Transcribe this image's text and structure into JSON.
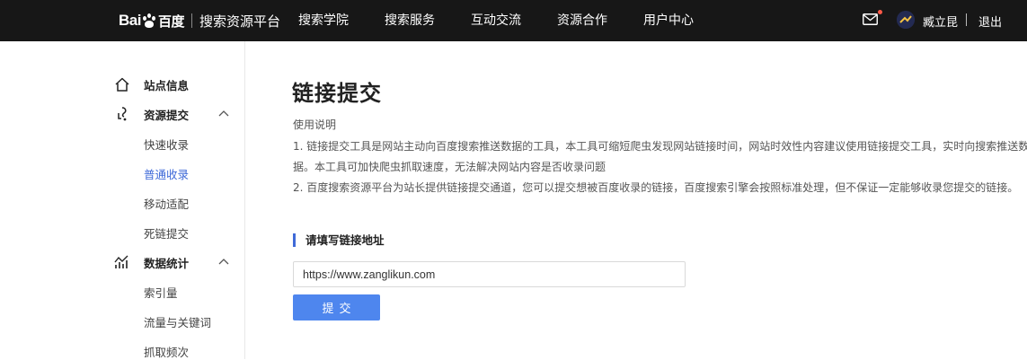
{
  "header": {
    "logo_text_1": "Bai",
    "logo_text_2": "百度",
    "logo_sub": "搜索资源平台",
    "nav": [
      "搜索学院",
      "搜索服务",
      "互动交流",
      "资源合作",
      "用户中心"
    ],
    "username": "臧立昆",
    "separator": "|",
    "logout": "退出",
    "mail_icon": "mail-icon",
    "notification_color": "#ff5a48"
  },
  "sidebar": {
    "groups": [
      {
        "label": "站点信息",
        "icon": "home-icon"
      },
      {
        "label": "资源提交",
        "icon": "resource-submit-icon",
        "expanded": true,
        "items": [
          "快速收录",
          "普通收录",
          "移动适配",
          "死链提交"
        ],
        "active_item": "普通收录"
      },
      {
        "label": "数据统计",
        "icon": "stats-chart-icon",
        "expanded": true,
        "items": [
          "索引量",
          "流量与关键词",
          "抓取频次"
        ]
      }
    ]
  },
  "main": {
    "title": "链接提交",
    "desc_heading": "使用说明",
    "desc_line1": "1. 链接提交工具是网站主动向百度搜索推送数据的工具，本工具可缩短爬虫发现网站链接时间，网站时效性内容建议使用链接提交工具，实时向搜索推送数",
    "desc_line2": "据。本工具可加快爬虫抓取速度，无法解决网站内容是否收录问题",
    "desc_line3": "2. 百度搜索资源平台为站长提供链接提交通道，您可以提交想被百度收录的链接，百度搜索引擎会按照标准处理，但不保证一定能够收录您提交的链接。",
    "section_label": "请填写链接地址",
    "url_value": "https://www.zanglikun.com",
    "submit_label": "提交"
  },
  "colors": {
    "accent": "#3f6ad8",
    "button": "#4e86ee",
    "topbar": "#171717"
  }
}
